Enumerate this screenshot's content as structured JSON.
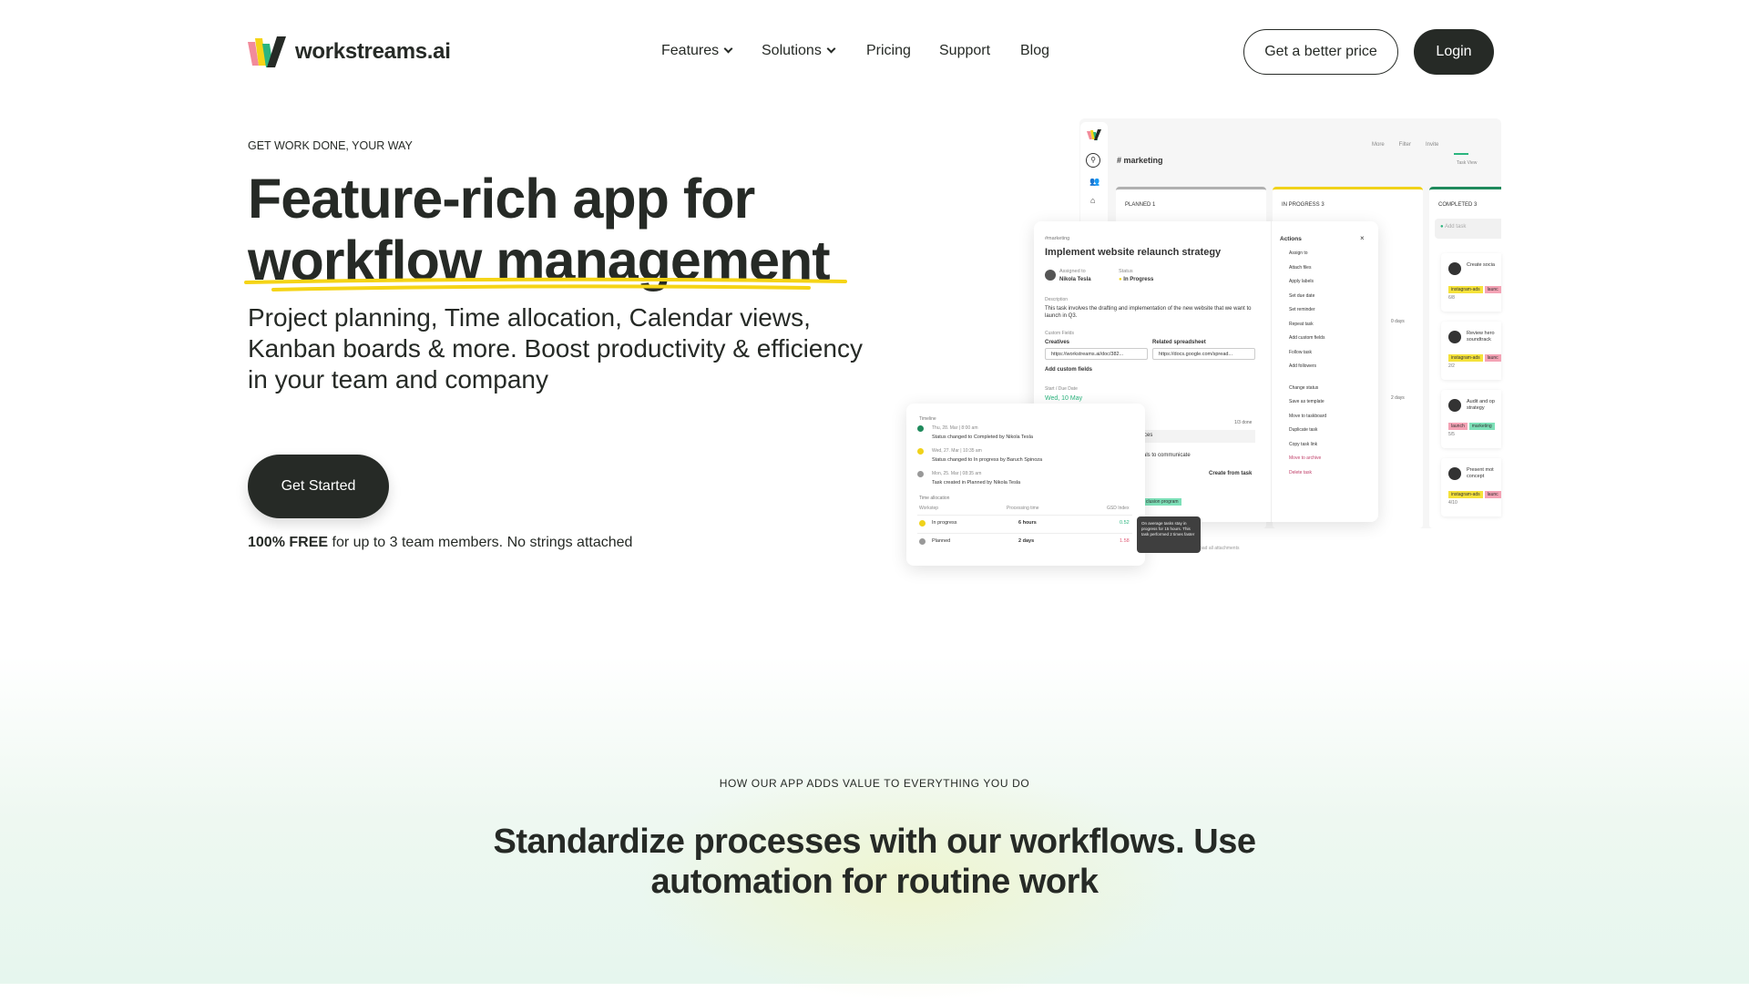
{
  "brand": {
    "name": "workstreams.ai",
    "colors": [
      "#f28b9b",
      "#f5d416",
      "#2bb57e",
      "#262a26"
    ]
  },
  "nav": {
    "items": [
      "Features",
      "Solutions",
      "Pricing",
      "Support",
      "Blog"
    ],
    "cta_outline": "Get a better price",
    "login": "Login"
  },
  "hero": {
    "eyebrow": "GET WORK DONE, YOUR WAY",
    "title_line1": "Feature-rich app for",
    "title_line2": "workflow management",
    "subtitle": "Project planning, Time allocation, Calendar views, Kanban boards & more. Boost productivity & efficiency in your team and company",
    "cta": "Get Started",
    "note_bold": "100% FREE",
    "note_rest": " for up to 3 team members. No strings attached",
    "underline_color": "#f5d416"
  },
  "mockup": {
    "channel": "# marketing",
    "toolbar": [
      "More",
      "Filter",
      "Invite"
    ],
    "task_view": "Task View",
    "columns": [
      {
        "label": "PLANNED 1",
        "color": "#b0b0b0"
      },
      {
        "label": "IN PROGRESS 3",
        "color": "#f0d21a"
      },
      {
        "label": "COMPLETED 3",
        "color": "#1f8a5c"
      }
    ],
    "add_task": "Add task",
    "completed_cards": [
      {
        "title": "Create socia",
        "tags": [
          "instagram-ads",
          "launc"
        ],
        "meta": "6/8"
      },
      {
        "title": "Review hero soundtrack",
        "tags": [
          "instagram-ads",
          "launc"
        ],
        "meta": "2/2"
      },
      {
        "title": "Audit and op strategy",
        "tags": [
          "launch",
          "marketing"
        ],
        "meta": "5/5"
      },
      {
        "title": "Present mot concept",
        "tags": [
          "instagram-ads",
          "launc"
        ],
        "meta": "4/10"
      }
    ],
    "progress_labels": [
      "0 days",
      "2 days"
    ],
    "task": {
      "channel": "#marketing",
      "title": "Implement website relaunch strategy",
      "assigned_label": "Assigned to",
      "assignee": "Nikola Tesla",
      "status_label": "Status",
      "status": "In Progress",
      "desc_label": "Description",
      "desc": "This task involves the drafting and implementation of the new website that we want to launch in Q3.",
      "custom_label": "Custom Fields",
      "field1_label": "Creatives",
      "field1": "https://workstreams.ai/doc/382...",
      "field2_label": "Related spreadsheet",
      "field2": "https://docs.google.com/spread...",
      "add_fields": "Add custom fields",
      "date_label": "Start / Due Date",
      "date": "Wed, 10 May",
      "done": "1/3 done",
      "sub1": "ctices",
      "sub2": "als to communicate",
      "create_from": "Create from task",
      "label_tag": "clusion program",
      "download": "load all attachments"
    },
    "actions": {
      "title": "Actions",
      "items": [
        "Assign to",
        "Attach files",
        "Apply labels",
        "Set due date",
        "Set reminder",
        "Repeat task",
        "Add custom fields",
        "Follow task",
        "Add followers",
        "Change status",
        "Save as template",
        "Move to taskboard",
        "Duplicate task",
        "Copy task link",
        "Move to archive",
        "Delete task"
      ]
    },
    "timeline": {
      "title": "Timeline",
      "events": [
        {
          "date": "Thu, 28. Mar | 8:00 am",
          "text": "Status changed to Completed by Nikola Tesla",
          "color": "#1f8a5c"
        },
        {
          "date": "Wed, 27. Mar | 10:35 am",
          "text": "Status changed to In progress by Baruch Spinoza",
          "color": "#f0d21a"
        },
        {
          "date": "Mon, 25. Mar | 08:35 am",
          "text": "Task created in Planned by Nikola Tesla",
          "color": "#999999"
        }
      ],
      "alloc_title": "Time allocation",
      "headers": [
        "Workstep",
        "Processing time",
        "GSD Index"
      ],
      "rows": [
        {
          "step": "In progress",
          "time": "6 hours",
          "index": "0.52",
          "color": "#f0d21a",
          "index_color": "#2bb57e"
        },
        {
          "step": "Planned",
          "time": "2 days",
          "index": "1.58",
          "color": "#999999",
          "index_color": "#e0607a"
        }
      ],
      "tooltip": "On average tasks stay in progress for 15 hours. This task performed 2 times faster"
    }
  },
  "section2": {
    "eyebrow": "HOW OUR APP ADDS VALUE TO EVERYTHING YOU DO",
    "title": "Standardize processes with our workflows. Use automation for routine work"
  }
}
